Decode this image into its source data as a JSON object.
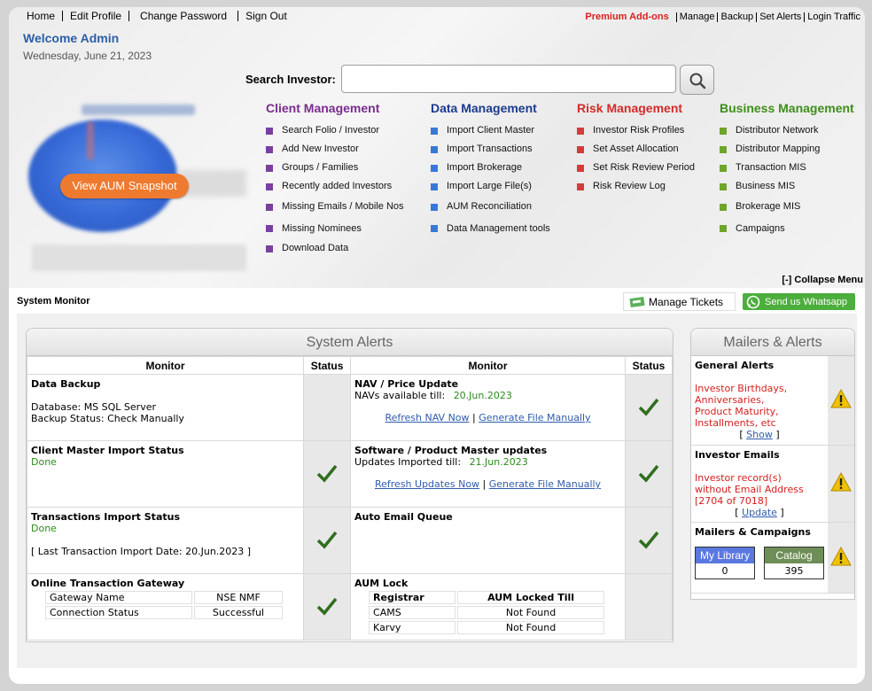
{
  "nav": {
    "left": [
      "Home",
      "Edit Profile",
      "Change Password",
      "Sign Out"
    ],
    "premium": "Premium Add-ons",
    "right": [
      "Manage",
      "Backup",
      "Set Alerts",
      "Login Traffic"
    ]
  },
  "welcome": "Welcome Admin",
  "date": "Wednesday, June 21, 2023",
  "search": {
    "label": "Search Investor:",
    "value": "",
    "button_icon": "search-icon"
  },
  "aum_button": "View AUM Snapshot",
  "menus": [
    {
      "title": "Client Management",
      "color": "#7a2c8e",
      "items": [
        "Search Folio / Investor",
        "Add New Investor",
        "Groups / Families",
        "Recently added Investors",
        "Missing Emails / Mobile Nos",
        "Missing Nominees",
        "Download Data"
      ]
    },
    {
      "title": "Data Management",
      "color": "#1b3a8f",
      "items": [
        "Import Client Master",
        "Import Transactions",
        "Import Brokerage",
        "Import Large File(s)",
        "AUM Reconciliation",
        "Data Management tools"
      ]
    },
    {
      "title": "Risk Management",
      "color": "#d42a2a",
      "items": [
        "Investor Risk Profiles",
        "Set Asset Allocation",
        "Set Risk Review Period",
        "Risk Review Log"
      ]
    },
    {
      "title": "Business Management",
      "color": "#3e8e1a",
      "items": [
        "Distributor Network",
        "Distributor Mapping",
        "Transaction MIS",
        "Business MIS",
        "Brokerage MIS",
        "Campaigns"
      ]
    }
  ],
  "square_colors": {
    "client": "#7b3fa0",
    "data": "#3a78d8",
    "risk": "#d63a3a",
    "business": "#6ea52a"
  },
  "collapse": "[-] Collapse Menu",
  "system_monitor": "System Monitor",
  "manage_tickets": "Manage Tickets",
  "whatsapp": "Send us Whatsapp",
  "alerts": {
    "title": "System Alerts",
    "headers": {
      "monitor": "Monitor",
      "status": "Status"
    },
    "data_backup": {
      "title": "Data Backup",
      "db": "Database: MS SQL Server",
      "status": "Backup Status: Check Manually"
    },
    "nav_price": {
      "title": "NAV / Price Update",
      "label": "NAVs available till:",
      "date": "20.Jun.2023",
      "link1": "Refresh NAV Now",
      "link2": "Generate File Manually"
    },
    "client_master": {
      "title": "Client Master Import Status",
      "state": "Done"
    },
    "software": {
      "title": "Software / Product Master updates",
      "label": "Updates Imported till:",
      "date": "21.Jun.2023",
      "link1": "Refresh Updates Now",
      "link2": "Generate File Manually"
    },
    "transactions": {
      "title": "Transactions Import Status",
      "state": "Done",
      "last": "[ Last Transaction Import Date: 20.Jun.2023 ]"
    },
    "auto_email": {
      "title": "Auto Email Queue"
    },
    "gateway": {
      "title": "Online Transaction Gateway",
      "rows": [
        [
          "Gateway Name",
          "NSE NMF"
        ],
        [
          "Connection Status",
          "Successful"
        ]
      ]
    },
    "aum_lock": {
      "title": "AUM Lock",
      "headers": [
        "Registrar",
        "AUM Locked Till"
      ],
      "rows": [
        [
          "CAMS",
          "Not Found"
        ],
        [
          "Karvy",
          "Not Found"
        ]
      ]
    }
  },
  "mailers": {
    "title": "Mailers & Alerts",
    "general": {
      "title": "General Alerts",
      "text": "Investor Birthdays, Anniversaries, Product Maturity, Installments, etc",
      "link": "Show"
    },
    "emails": {
      "title": "Investor Emails",
      "text": "Investor record(s) without Email Address [2704 of 7018]",
      "link": "Update"
    },
    "campaigns": {
      "title": "Mailers & Campaigns",
      "library": {
        "label": "My Library",
        "value": "0"
      },
      "catalog": {
        "label": "Catalog",
        "value": "395"
      }
    }
  }
}
